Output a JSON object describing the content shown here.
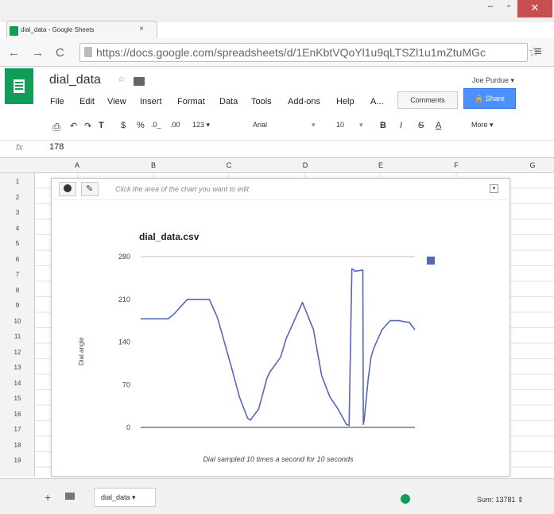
{
  "browser": {
    "tab_title": "dial_data - Google Sheets",
    "tab_close": "×",
    "url": "https://docs.google.com/spreadsheets/d/1EnKbtVQoYl1u9qLTSZl1u1mZtuMGc",
    "star": "☆",
    "menu": "≡"
  },
  "sheets": {
    "doc_title": "dial_data",
    "user": "Joe Purdue ▾",
    "menu": [
      "File",
      "Edit",
      "View",
      "Insert",
      "Format",
      "Data",
      "Tools",
      "Add-ons",
      "Help",
      "A..."
    ],
    "comments_label": "Comments",
    "share_label": "Share",
    "toolbar": {
      "currency": "$",
      "percent": "%",
      "dec1": ".0_",
      "dec2": ".00",
      "format": "123 ▾",
      "font": "Arial",
      "font_size": "10",
      "bold": "B",
      "italic": "I",
      "strike": "S",
      "text_color": "A",
      "more": "More ▾"
    },
    "fx": "fx",
    "formula_value": "178",
    "columns": [
      "A",
      "B",
      "C",
      "D",
      "E",
      "F",
      "G"
    ],
    "rows": [
      "1",
      "2",
      "3",
      "4",
      "5",
      "6",
      "7",
      "8",
      "9",
      "10",
      "11",
      "12",
      "13",
      "14",
      "15",
      "16",
      "17",
      "18",
      "19"
    ],
    "chart_hint": "Click the area of the chart you want to edit",
    "sheet_tab": "dial_data ▾",
    "sum": "Sum: 13781 ⇕"
  },
  "chart_data": {
    "type": "line",
    "title": "dial_data.csv",
    "xlabel": "Dial sampled 10 times a second for 10 seconds",
    "ylabel": "Dial angle",
    "yticks": [
      0,
      70,
      140,
      210,
      280
    ],
    "ylim": [
      0,
      280
    ],
    "xlim": [
      0,
      100
    ],
    "series": [
      {
        "color": "#5566bb",
        "x": [
          0,
          10,
          12,
          17,
          19,
          25,
          28,
          33,
          36,
          39,
          40,
          43,
          46,
          47,
          51,
          53,
          59,
          63,
          66,
          69,
          72,
          75,
          76,
          77,
          77.8,
          78,
          81,
          81.2,
          81.5,
          83,
          84,
          85,
          88,
          91,
          94,
          98,
          100
        ],
        "y": [
          178,
          178,
          185,
          210,
          210,
          210,
          180,
          100,
          50,
          15,
          12,
          30,
          80,
          90,
          115,
          145,
          205,
          160,
          85,
          50,
          30,
          5,
          3,
          260,
          258,
          256,
          258,
          5,
          12,
          80,
          115,
          130,
          160,
          175,
          175,
          172,
          160
        ]
      }
    ],
    "grid": false,
    "legend": "right"
  }
}
